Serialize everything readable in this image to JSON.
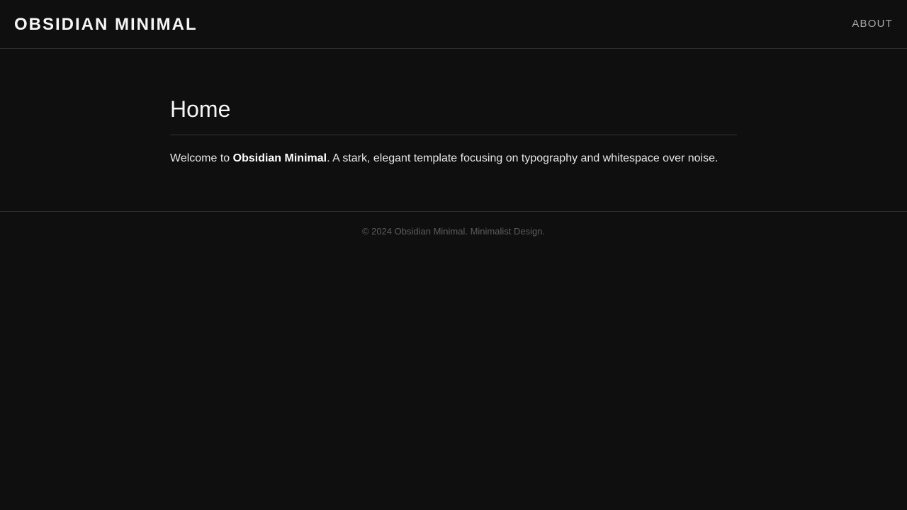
{
  "header": {
    "brand": "OBSIDIAN MINIMAL",
    "nav": [
      {
        "label": "ABOUT"
      }
    ]
  },
  "main": {
    "title": "Home",
    "intro_prefix": "Welcome to ",
    "intro_strong": "Obsidian Minimal",
    "intro_suffix": ". A stark, elegant template focusing on typography and whitespace over noise."
  },
  "footer": {
    "text": "© 2024 Obsidian Minimal. Minimalist Design."
  },
  "colors": {
    "background": "#0f0f0f",
    "text": "#eaeaea",
    "muted": "#a9a9a9",
    "footer_text": "#5c5c5c",
    "divider": "#2e2e2e"
  }
}
